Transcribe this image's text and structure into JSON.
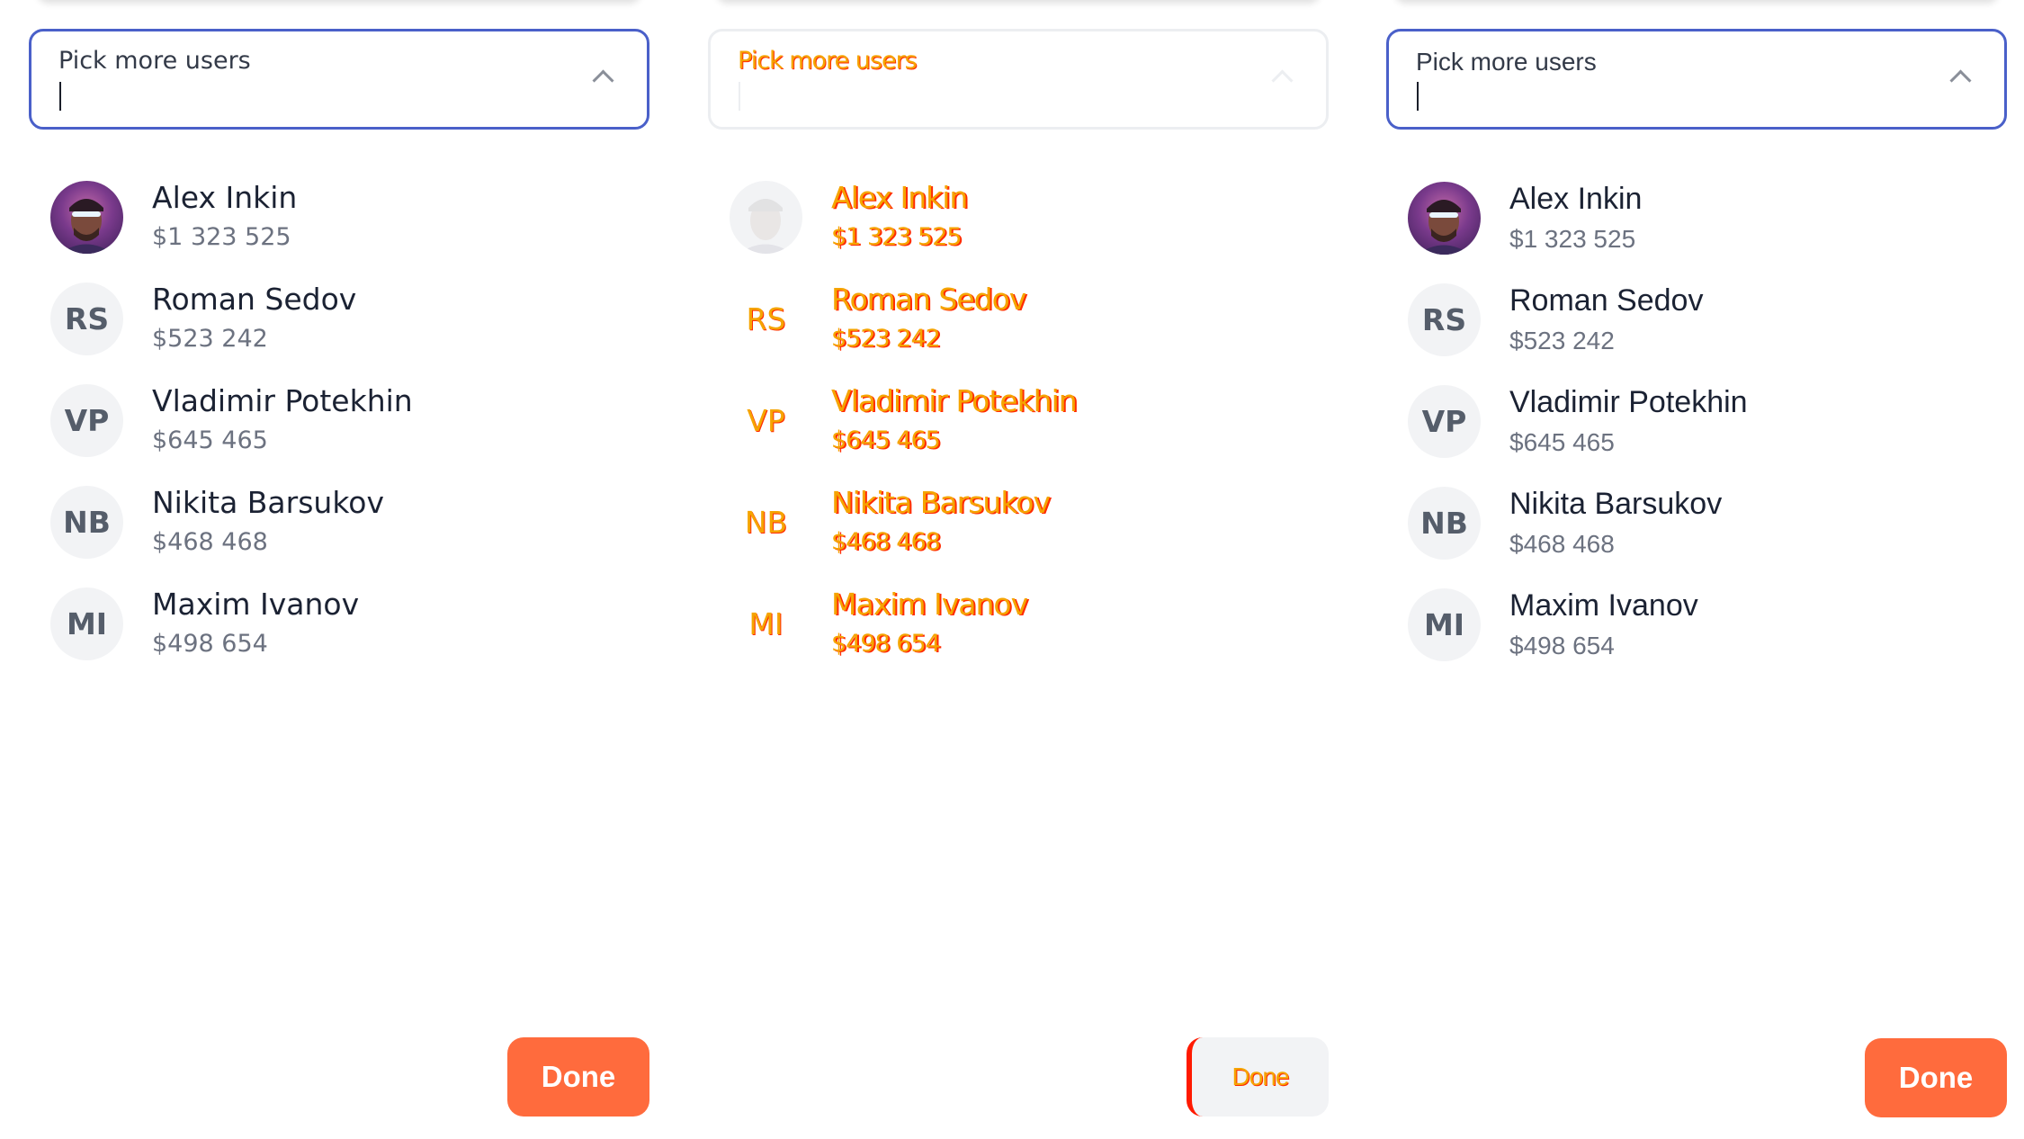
{
  "colors": {
    "accent_border": "#4a60c9",
    "done_button": "#ff6b3d",
    "avatar_bg": "#f2f3f5",
    "ghost_text": "#f5a400",
    "ghost_shadow": "#ff2b00"
  },
  "panels": [
    {
      "select": {
        "placeholder": "Pick more users",
        "icon": "chevron-up-icon"
      },
      "users": [
        {
          "name": "Alex Inkin",
          "amount": "$1 323 525",
          "initials": ""
        },
        {
          "name": "Roman Sedov",
          "amount": "$523 242",
          "initials": "RS"
        },
        {
          "name": "Vladimir Potekhin",
          "amount": "$645 465",
          "initials": "VP"
        },
        {
          "name": "Nikita Barsukov",
          "amount": "$468 468",
          "initials": "NB"
        },
        {
          "name": "Maxim Ivanov",
          "amount": "$498 654",
          "initials": "MI"
        }
      ],
      "done_label": "Done"
    },
    {
      "select": {
        "placeholder": "Pick more users",
        "icon": "chevron-up-icon"
      },
      "users": [
        {
          "name": "Alex Inkin",
          "amount": "$1 323 525",
          "initials": ""
        },
        {
          "name": "Roman Sedov",
          "amount": "$523 242",
          "initials": "RS"
        },
        {
          "name": "Vladimir Potekhin",
          "amount": "$645 465",
          "initials": "VP"
        },
        {
          "name": "Nikita Barsukov",
          "amount": "$468 468",
          "initials": "NB"
        },
        {
          "name": "Maxim Ivanov",
          "amount": "$498 654",
          "initials": "MI"
        }
      ],
      "done_label": "Done"
    },
    {
      "select": {
        "placeholder": "Pick more users",
        "icon": "chevron-up-icon"
      },
      "users": [
        {
          "name": "Alex Inkin",
          "amount": "$1 323 525",
          "initials": ""
        },
        {
          "name": "Roman Sedov",
          "amount": "$523 242",
          "initials": "RS"
        },
        {
          "name": "Vladimir Potekhin",
          "amount": "$645 465",
          "initials": "VP"
        },
        {
          "name": "Nikita Barsukov",
          "amount": "$468 468",
          "initials": "NB"
        },
        {
          "name": "Maxim Ivanov",
          "amount": "$498 654",
          "initials": "MI"
        }
      ],
      "done_label": "Done"
    }
  ]
}
